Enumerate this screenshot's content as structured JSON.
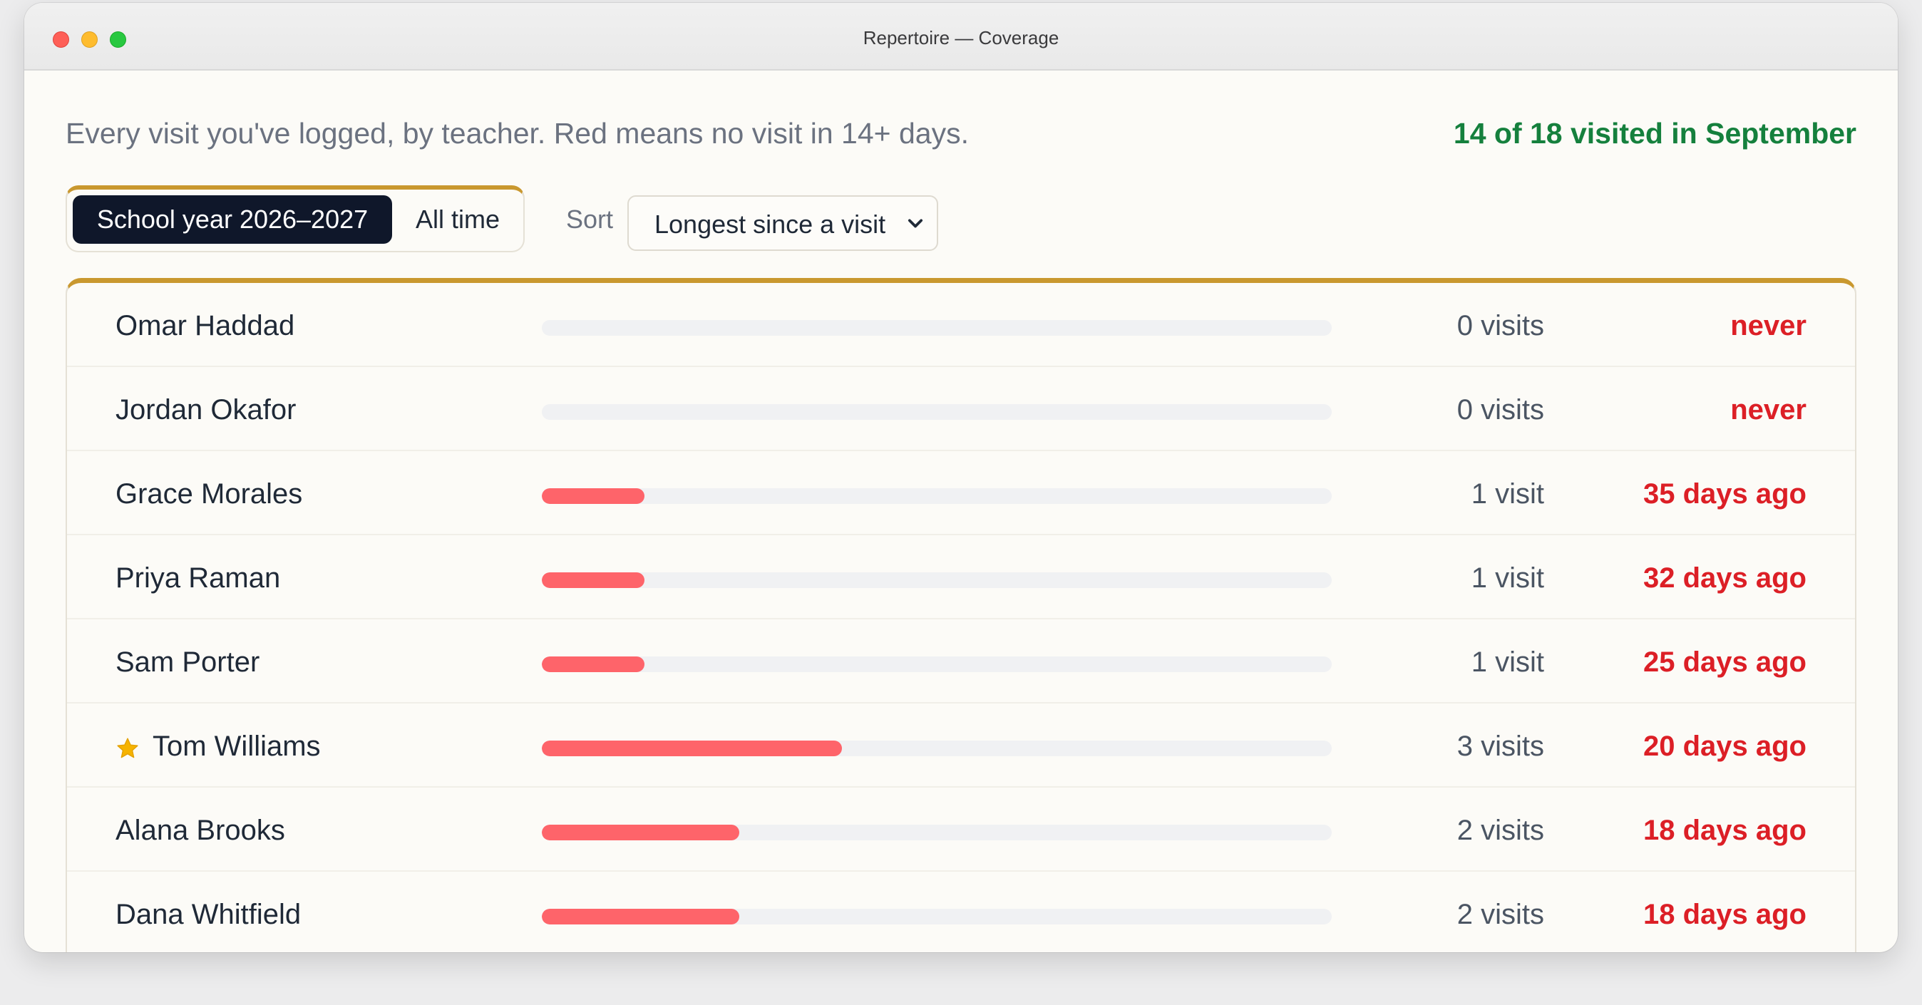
{
  "window": {
    "title": "Repertoire — Coverage"
  },
  "header": {
    "subtitle": "Every visit you've logged, by teacher. Red means no visit in 14+ days.",
    "summary": "14 of 18 visited in September"
  },
  "filters": {
    "segments": [
      "School year 2026–2027",
      "All time"
    ],
    "active_segment": "School year 2026–2027",
    "sort_label": "Sort",
    "sort_value": "Longest since a visit"
  },
  "colors": {
    "accent_gold": "#c9982f",
    "bar_fill": "#fe646a",
    "overdue_red": "#dc1f26",
    "summary_green": "#15803d",
    "active_segment_bg": "#0f172a"
  },
  "teachers": [
    {
      "name": "Omar Haddad",
      "visits_label": "0 visits",
      "visits": 0,
      "last_visit": "never",
      "starred": false,
      "bar_fraction": 0
    },
    {
      "name": "Jordan Okafor",
      "visits_label": "0 visits",
      "visits": 0,
      "last_visit": "never",
      "starred": false,
      "bar_fraction": 0
    },
    {
      "name": "Grace Morales",
      "visits_label": "1 visit",
      "visits": 1,
      "last_visit": "35 days ago",
      "starred": false,
      "bar_fraction": 0.13
    },
    {
      "name": "Priya Raman",
      "visits_label": "1 visit",
      "visits": 1,
      "last_visit": "32 days ago",
      "starred": false,
      "bar_fraction": 0.13
    },
    {
      "name": "Sam Porter",
      "visits_label": "1 visit",
      "visits": 1,
      "last_visit": "25 days ago",
      "starred": false,
      "bar_fraction": 0.13
    },
    {
      "name": "Tom Williams",
      "visits_label": "3 visits",
      "visits": 3,
      "last_visit": "20 days ago",
      "starred": true,
      "star_icon": "star-icon",
      "bar_fraction": 0.38
    },
    {
      "name": "Alana Brooks",
      "visits_label": "2 visits",
      "visits": 2,
      "last_visit": "18 days ago",
      "starred": false,
      "bar_fraction": 0.25
    },
    {
      "name": "Dana Whitfield",
      "visits_label": "2 visits",
      "visits": 2,
      "last_visit": "18 days ago",
      "starred": false,
      "bar_fraction": 0.25
    }
  ]
}
